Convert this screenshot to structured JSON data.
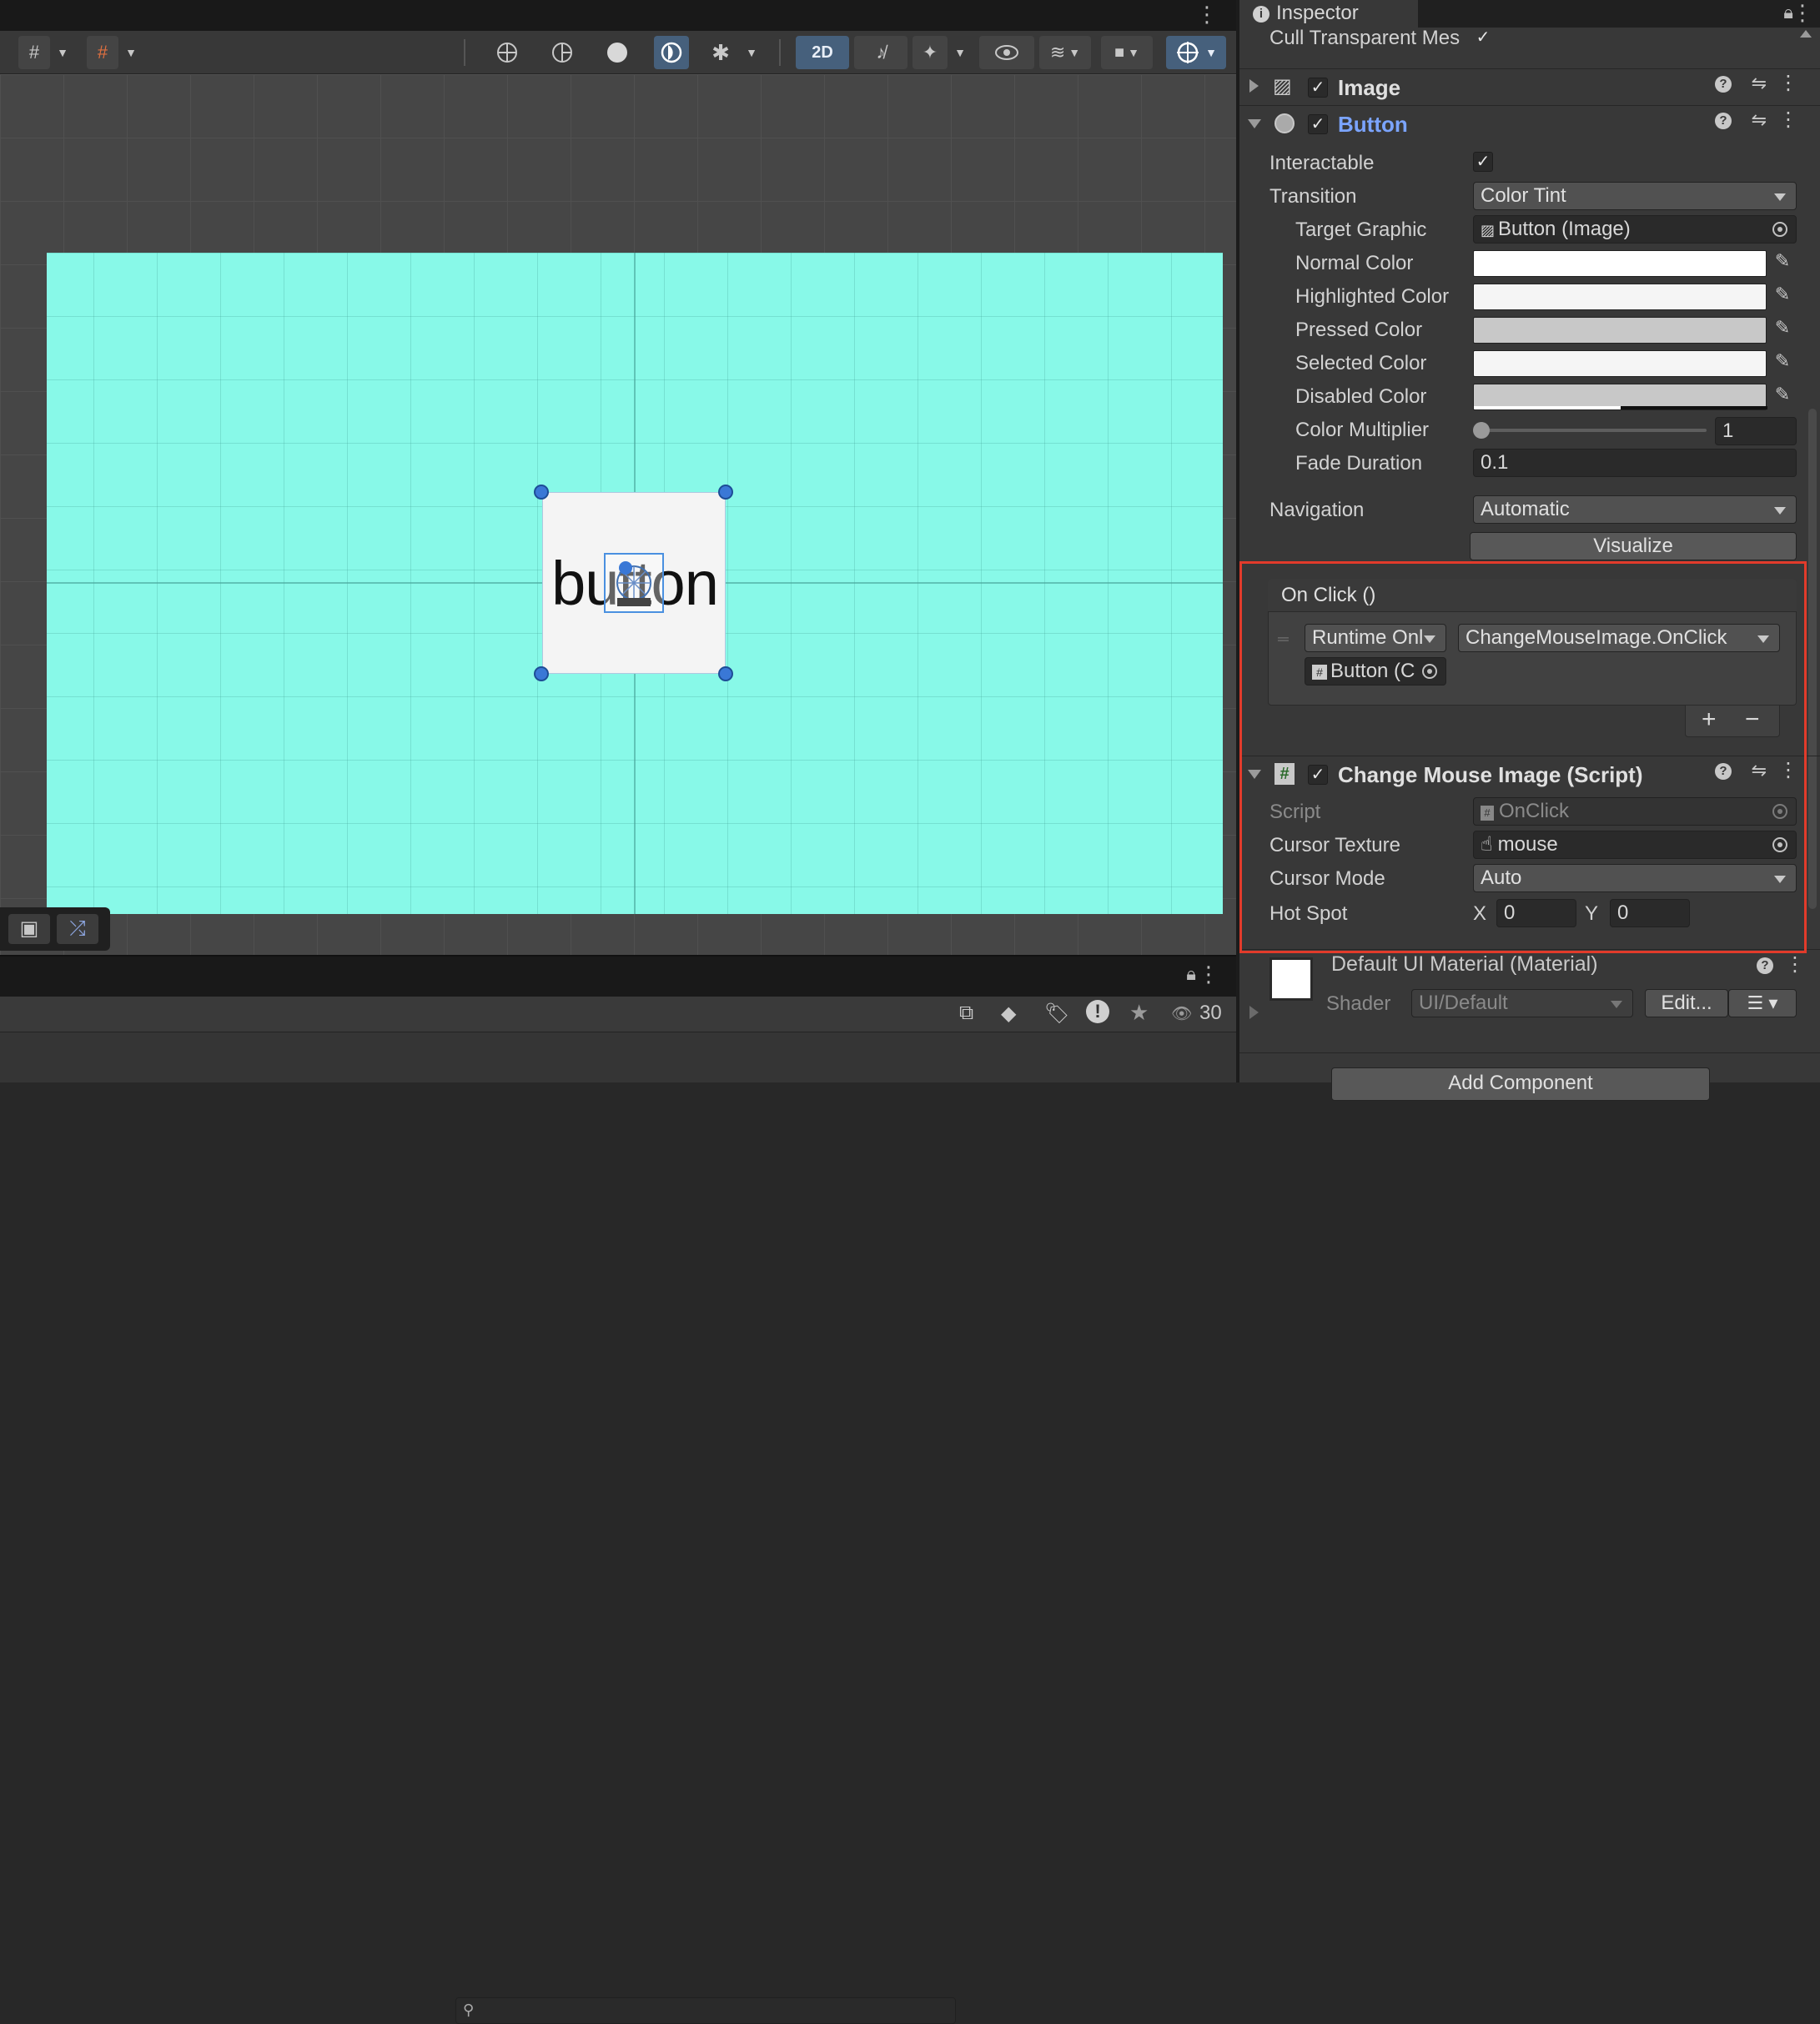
{
  "inspector": {
    "tab_title": "Inspector",
    "cull_label": "Cull Transparent Mes",
    "components": {
      "image": {
        "title": "Image"
      },
      "button": {
        "title": "Button"
      },
      "change_mouse": {
        "title": "Change Mouse Image (Script)"
      },
      "material": {
        "title": "Default UI Material (Material)",
        "shader_label": "Shader",
        "shader_value": "UI/Default",
        "edit_label": "Edit..."
      }
    },
    "button_props": {
      "interactable_label": "Interactable",
      "transition_label": "Transition",
      "transition_value": "Color Tint",
      "target_graphic_label": "Target Graphic",
      "target_graphic_value": "Button (Image)",
      "normal_color_label": "Normal Color",
      "highlighted_color_label": "Highlighted Color",
      "pressed_color_label": "Pressed Color",
      "selected_color_label": "Selected Color",
      "disabled_color_label": "Disabled Color",
      "color_multiplier_label": "Color Multiplier",
      "color_multiplier_value": "1",
      "fade_duration_label": "Fade Duration",
      "fade_duration_value": "0.1",
      "navigation_label": "Navigation",
      "navigation_value": "Automatic",
      "visualize_label": "Visualize"
    },
    "onclick": {
      "header": "On Click ()",
      "runtime_value": "Runtime Onl",
      "function_value": "ChangeMouseImage.OnClick",
      "object_value": "Button (C",
      "plus": "+",
      "minus": "−"
    },
    "script_props": {
      "script_label": "Script",
      "script_value": "OnClick",
      "cursor_texture_label": "Cursor Texture",
      "cursor_texture_value": "mouse",
      "cursor_mode_label": "Cursor Mode",
      "cursor_mode_value": "Auto",
      "hotspot_label": "Hot Spot",
      "x_label": "X",
      "x_value": "0",
      "y_label": "Y",
      "y_value": "0"
    },
    "add_component": "Add Component"
  },
  "scene": {
    "toolbar": {
      "mode_2d": "2D"
    },
    "button_text": "button",
    "hidden_count": "30"
  },
  "colors": {
    "canvas_bg": "#88f9e8",
    "normal_color": "#ffffff",
    "highlighted_color": "#f5f5f5",
    "pressed_color": "#c8c8c8",
    "selected_color": "#f5f5f5",
    "disabled_color": "#c8c8c8",
    "highlight_box": "#e23b2b",
    "button_title_accent": "#7ba4ff"
  }
}
